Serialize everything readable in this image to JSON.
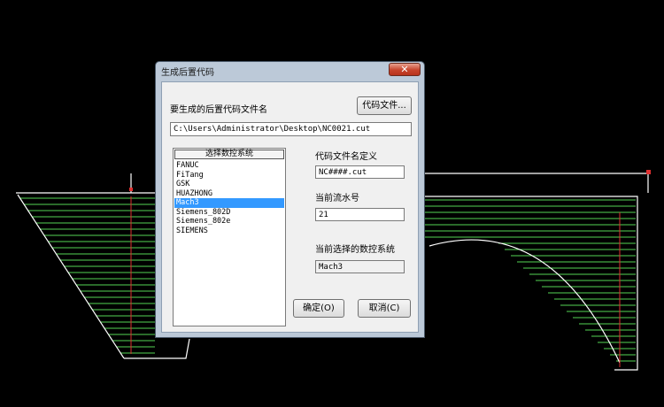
{
  "dialog": {
    "title": "生成后置代码",
    "close_glyph": "✕",
    "filename_label": "要生成的后置代码文件名",
    "code_file_button": "代码文件...",
    "file_path": "C:\\Users\\Administrator\\Desktop\\NC0021.cut",
    "list_header": "选择数控系统",
    "cnc_systems": [
      "FANUC",
      "FiTang",
      "GSK",
      "HUAZHONG",
      "Mach3",
      "Siemens_802D",
      "Siemens_802e",
      "SIEMENS"
    ],
    "selected_system": "Mach3",
    "name_def_label": "代码文件名定义",
    "name_def_value": "NC####.cut",
    "serial_label": "当前流水号",
    "serial_value": "21",
    "current_system_label": "当前选择的数控系统",
    "current_system_value": "Mach3",
    "ok_button": "确定(O)",
    "cancel_button": "取消(C)"
  },
  "colors": {
    "canvas_bg": "#000000",
    "toolpath": "#ffffff",
    "hatch": "#55d455",
    "marker": "#e03030",
    "selection": "#3399ff"
  }
}
